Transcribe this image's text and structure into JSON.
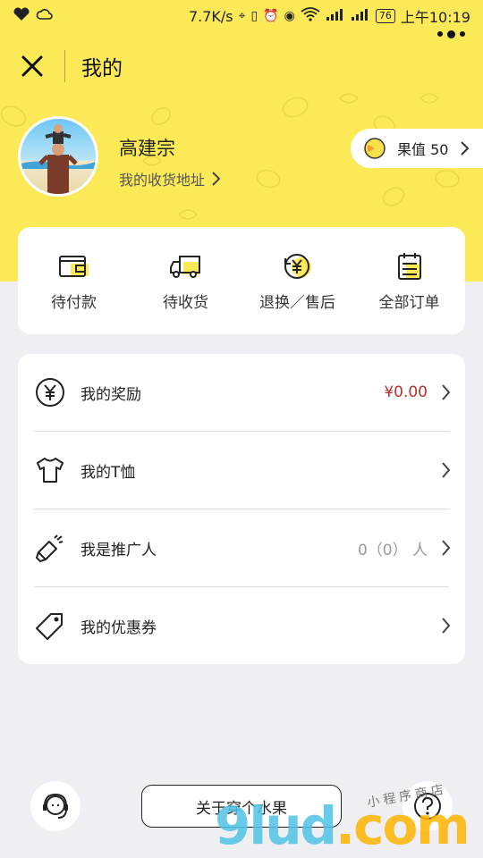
{
  "status_bar": {
    "speed": "7.7K/s",
    "battery": "76",
    "time": "上午10:19"
  },
  "nav": {
    "title": "我的"
  },
  "profile": {
    "name": "高建宗",
    "address_link": "我的收货地址",
    "fruit_value_label": "果值 50"
  },
  "orders": [
    {
      "label": "待付款",
      "icon": "wallet-icon"
    },
    {
      "label": "待收货",
      "icon": "truck-icon"
    },
    {
      "label": "退换／售后",
      "icon": "refund-yen-icon"
    },
    {
      "label": "全部订单",
      "icon": "order-list-icon"
    }
  ],
  "menu": [
    {
      "label": "我的奖励",
      "value": "¥0.00",
      "icon": "yen-circle-icon"
    },
    {
      "label": "我的T恤",
      "value": "",
      "icon": "tshirt-icon"
    },
    {
      "label": "我是推广人",
      "value": "0（0） 人",
      "icon": "megaphone-icon"
    },
    {
      "label": "我的优惠券",
      "value": "",
      "icon": "tag-icon"
    }
  ],
  "bottom": {
    "about_label": "关于穿个水果",
    "left_icon": "customer-service-icon",
    "right_icon": "help-icon"
  },
  "watermark": {
    "main": "9lud",
    "dot_com": ".com",
    "small": "小程序商店"
  },
  "colors": {
    "brand_yellow": "#fbe957",
    "reward_red": "#b5312b",
    "background": "#efeef2"
  }
}
